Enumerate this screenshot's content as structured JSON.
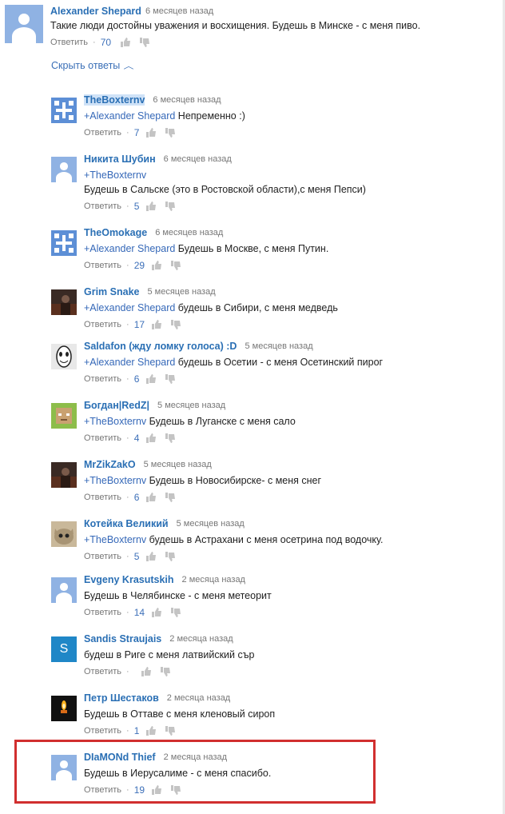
{
  "main_comment": {
    "author": "Alexander Shepard",
    "time": "6 месяцев назад",
    "text": "Такие люди достойны уважения и восхищения. Будешь в Минске - с меня пиво.",
    "reply_label": "Ответить",
    "likes": "70"
  },
  "hide_replies_label": "Скрыть ответы",
  "replies": [
    {
      "author": "TheBoxternv",
      "time": "6 месяцев назад",
      "mention": "+Alexander Shepard",
      "text": " Непременно :)",
      "reply_label": "Ответить",
      "likes": "7",
      "avatar": "pattern-icon"
    },
    {
      "author": "Никита Шубин",
      "time": "6 месяцев назад",
      "mention": "+TheBoxternv",
      "text": "Будешь в Сальске (это в Ростовской области),с меня Пепси)",
      "reply_label": "Ответить",
      "likes": "5",
      "avatar": "default-user-icon"
    },
    {
      "author": "TheOmokage",
      "time": "6 месяцев назад",
      "mention": "+Alexander Shepard",
      "text": " Будешь в Москве, с меня Путин.",
      "reply_label": "Ответить",
      "likes": "29",
      "avatar": "pattern-icon"
    },
    {
      "author": "Grim Snake",
      "time": "5 месяцев назад",
      "mention": "+Alexander Shepard",
      "text": " будешь в Сибири, с меня медведь",
      "reply_label": "Ответить",
      "likes": "17",
      "avatar": "photo-avatar"
    },
    {
      "author": "Saldafon (жду ломку голоса) :D",
      "time": "5 месяцев назад",
      "mention": "+Alexander Shepard",
      "text": " будешь в Осетии - с меня Осетинский пирог",
      "reply_label": "Ответить",
      "likes": "6",
      "avatar": "mask-avatar"
    },
    {
      "author": "Богдан|RedZ|",
      "time": "5 месяцев назад",
      "mention": "+TheBoxternv",
      "text": " Будешь в Луганске с меня сало",
      "reply_label": "Ответить",
      "likes": "4",
      "avatar": "blocky-avatar"
    },
    {
      "author": "MrZikZakO",
      "time": "5 месяцев назад",
      "mention": "+TheBoxternv",
      "text": " Будешь в Новосибирске- с меня снег",
      "reply_label": "Ответить",
      "likes": "6",
      "avatar": "photo-avatar"
    },
    {
      "author": "Котейка Великий",
      "time": "5 месяцев назад",
      "mention": "+TheBoxternv",
      "text": "  будешь в Астрахани с меня осетрина под водочку.",
      "reply_label": "Ответить",
      "likes": "5",
      "avatar": "cat-avatar"
    },
    {
      "author": "Evgeny Krasutskih",
      "time": "2 месяца назад",
      "mention": "",
      "text": "Будешь в Челябинске - с меня метеорит",
      "reply_label": "Ответить",
      "likes": "14",
      "avatar": "default-user-icon"
    },
    {
      "author": "Sandis Straujais",
      "time": "2 месяца назад",
      "mention": "",
      "text": "будеш в Риге с меня латвийский сър",
      "reply_label": "Ответить",
      "likes": "",
      "avatar": "letter-s-avatar"
    },
    {
      "author": "Петр Шестаков",
      "time": "2 месяца назад",
      "mention": "",
      "text": "Будешь в Оттаве с меня кленовый сироп",
      "reply_label": "Ответить",
      "likes": "1",
      "avatar": "candle-avatar"
    },
    {
      "author": "DIaMONd Thief",
      "time": "2 месяца назад",
      "mention": "",
      "text": "Будешь в Иерусалиме - с меня спасибо.",
      "reply_label": "Ответить",
      "likes": "19",
      "avatar": "default-user-icon"
    }
  ],
  "sandis_avatar_letter": "S",
  "colors": {
    "link": "#2a6fb4",
    "highlight_border": "#d12f2f",
    "avatar_blue": "#8fb2e3"
  }
}
